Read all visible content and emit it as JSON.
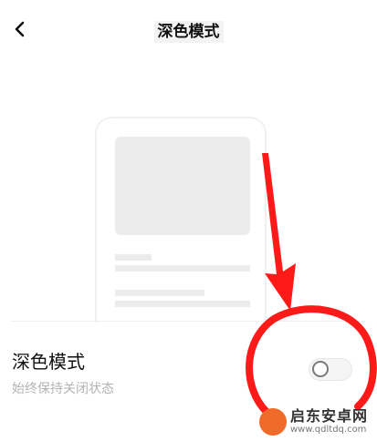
{
  "header": {
    "title": "深色模式",
    "back_icon": "chevron-left-icon"
  },
  "setting": {
    "title": "深色模式",
    "subtitle": "始终保持关闭状态",
    "toggle_on": false
  },
  "annotation": {
    "color": "#ff1a1a"
  },
  "watermark": {
    "title": "启东安卓网",
    "url": "www.qdltdq.com"
  }
}
